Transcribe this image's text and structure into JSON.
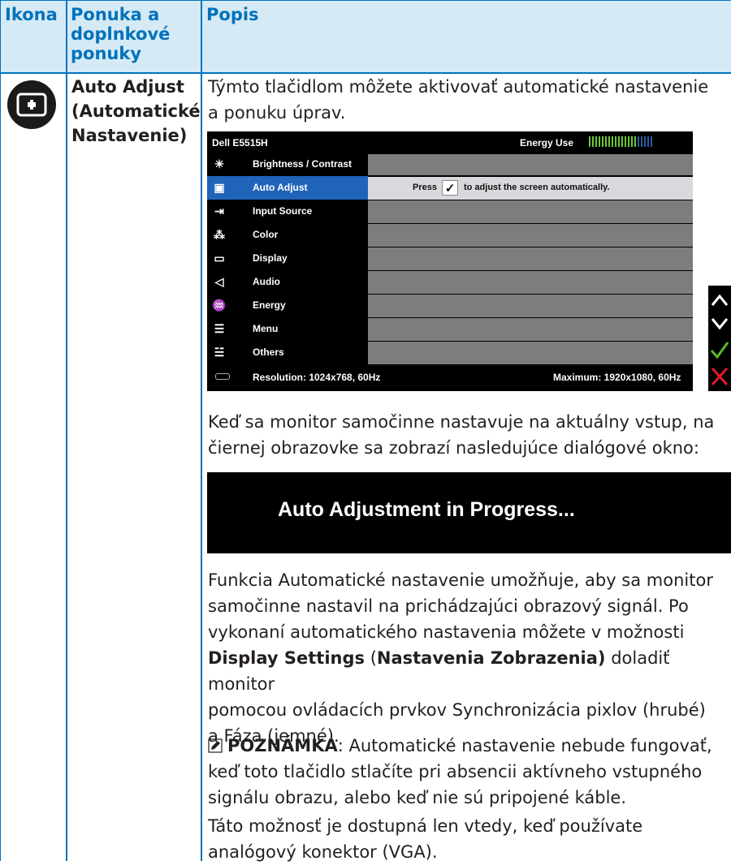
{
  "header": {
    "col_icon": "Ikona",
    "col_menu": "Ponuka a doplnkové ponuky",
    "col_desc": "Popis"
  },
  "row": {
    "icon_name": "auto-adjust-icon",
    "menu_line1": "Auto Adjust",
    "menu_line2": "(Automatické",
    "menu_line3": "Nastavenie)",
    "intro_line1": "Týmto tlačidlom môžete aktivovať automatické nastavenie",
    "intro_line2": "a ponuku úprav."
  },
  "osd": {
    "model": "Dell E5515H",
    "energy_label": "Energy Use",
    "energy_level": 0.75,
    "items": [
      {
        "label": "Brightness / Contrast",
        "icon": "brightness-icon"
      },
      {
        "label": "Auto Adjust",
        "icon": "auto-adjust-icon",
        "selected": true
      },
      {
        "label": "Input Source",
        "icon": "input-source-icon"
      },
      {
        "label": "Color",
        "icon": "color-icon"
      },
      {
        "label": "Display",
        "icon": "display-icon"
      },
      {
        "label": "Audio",
        "icon": "audio-icon"
      },
      {
        "label": "Energy",
        "icon": "energy-icon"
      },
      {
        "label": "Menu",
        "icon": "menu-icon"
      },
      {
        "label": "Others",
        "icon": "others-icon"
      }
    ],
    "press_prefix": "Press",
    "press_suffix": "to adjust the screen automatically.",
    "resolution": "Resolution: 1024x768, 60Hz",
    "maximum": "Maximum: 1920x1080, 60Hz",
    "colors": {
      "selected": "#1f64b9",
      "row": "#7d7d7d",
      "active_row": "#d7d9dc"
    }
  },
  "side_buttons": [
    "up-arrow",
    "down-arrow",
    "check",
    "close"
  ],
  "para1_line1": "Keď sa monitor samočinne nastavuje na aktuálny vstup, na",
  "para1_line2": "čiernej obrazovke sa zobrazí nasledujúce dialógové okno:",
  "dialog_text": "Auto Adjustment in Progress...",
  "para2": {
    "l1": "Funkcia Automatické nastavenie umožňuje, aby sa monitor",
    "l2": "samočinne nastavil na prichádzajúci obrazový signál. Po",
    "l3": "vykonaní automatického nastavenia môžete v možnosti",
    "l4_b1": "Display Settings",
    "l4_mid": " (",
    "l4_b2": "Nastavenia Zobrazenia)",
    "l4_rest": " doladiť monitor",
    "l5": "pomocou ovládacích prvkov Synchronizácia pixlov (hrubé)",
    "l6": "a Fáza (jemné)."
  },
  "note": {
    "label": "POZNÁMKA",
    "l1": ": Automatické nastavenie nebude fungovať,",
    "l2": "keď toto tlačidlo stlačíte pri absencii aktívneho vstupného",
    "l3": "signálu obrazu, alebo keď nie sú pripojené káble."
  },
  "para3": {
    "l1": "Táto možnosť je dostupná len vtedy, keď používate",
    "l2": "analógový konektor (VGA)."
  }
}
